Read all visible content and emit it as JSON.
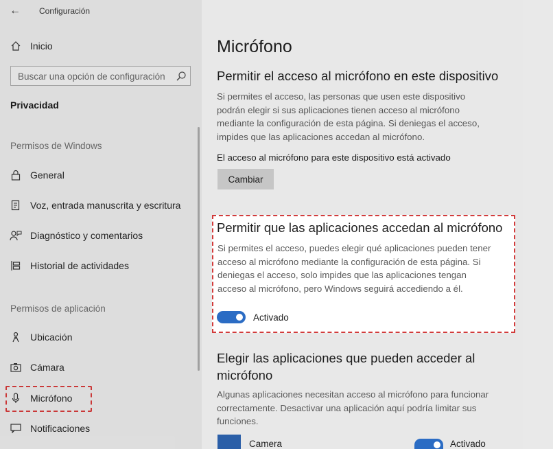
{
  "titlebar": {
    "back_glyph": "←",
    "title": "Configuración"
  },
  "sidebar": {
    "home_label": "Inicio",
    "search_placeholder": "Buscar una opción de configuración",
    "section_title": "Privacidad",
    "windows_permissions_heading": "Permisos de Windows",
    "windows_items": [
      {
        "label": "General",
        "icon": "lock-icon"
      },
      {
        "label": "Voz, entrada manuscrita y escritura",
        "icon": "document-pen-icon"
      },
      {
        "label": "Diagnóstico y comentarios",
        "icon": "person-feedback-icon"
      },
      {
        "label": "Historial de actividades",
        "icon": "timeline-icon"
      }
    ],
    "app_permissions_heading": "Permisos de aplicación",
    "app_items": [
      {
        "label": "Ubicación",
        "icon": "location-person-icon"
      },
      {
        "label": "Cámara",
        "icon": "camera-icon"
      },
      {
        "label": "Micrófono",
        "icon": "microphone-icon",
        "selected": true
      },
      {
        "label": "Notificaciones",
        "icon": "message-icon"
      }
    ]
  },
  "main": {
    "page_title": "Micrófono",
    "device_section": {
      "heading": "Permitir el acceso al micrófono en este dispositivo",
      "desc_lines": [
        "Si permites el acceso, las personas que usen este dispositivo",
        "podrán elegir si sus aplicaciones tienen acceso al micrófono",
        "mediante la configuración de esta página. Si deniegas el acceso,",
        "impides que las aplicaciones accedan al micrófono."
      ],
      "status": "El acceso al micrófono para este dispositivo está activado",
      "change_button": "Cambiar"
    },
    "apps_section": {
      "heading": "Permitir que las aplicaciones accedan al micrófono",
      "desc_lines": [
        "Si permites el acceso, puedes elegir qué aplicaciones pueden tener",
        "acceso al micrófono mediante la configuración de esta página. Si",
        "deniegas el acceso, solo impides que las aplicaciones tengan",
        "acceso al micrófono, pero Windows seguirá accediendo a él."
      ],
      "toggle_state": "Activado",
      "toggle_on": true
    },
    "choose_section": {
      "heading_lines": [
        "Elegir las aplicaciones que pueden acceder al",
        "micrófono"
      ],
      "desc_lines": [
        "Algunas aplicaciones necesitan acceso al micrófono para funcionar",
        "correctamente. Desactivar una aplicación aquí podría limitar sus",
        "funciones."
      ],
      "apps": [
        {
          "name": "Camera",
          "state": "Activado",
          "on": true
        }
      ]
    }
  },
  "colors": {
    "accent": "#2b6cc4",
    "highlight": "#d23b3b"
  }
}
